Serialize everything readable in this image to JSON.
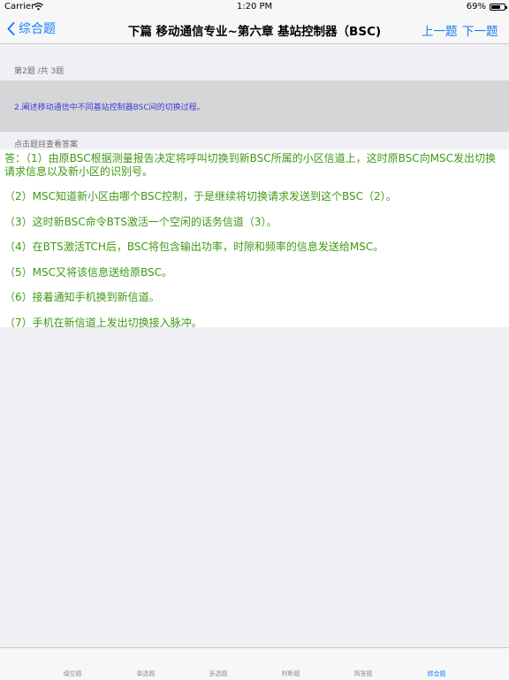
{
  "status_bar": {
    "carrier": "Carrier",
    "time": "1:20 PM",
    "battery": "69%",
    "battery_level": 0.69
  },
  "nav": {
    "back_label": "综合题",
    "title": "下篇 移动通信专业~第六章 基站控制器（BSC)",
    "prev_label": "上一题",
    "next_label": "下一题"
  },
  "question": {
    "progress": "第2题 /共 3题",
    "text": "2.阐述移动通信中不同基站控制器BSC间的切换过程。",
    "hint": "点击题目查看答案"
  },
  "answer": {
    "lines": [
      "答：（1）由原BSC根据测量报告决定将呼叫切换到新BSC所属的小区信道上，这时原BSC向MSC发出切换请求信息以及新小区的识别号。",
      "（2）MSC知道新小区由哪个BSC控制，于是继续将切换请求发送到这个BSC（2）。",
      "（3）这时新BSC命令BTS激活一个空闲的话务信道（3）。",
      "（4）在BTS激活TCH后，BSC将包含输出功率，时隙和频率的信息发送给MSC。",
      "（5）MSC又将该信息送给原BSC。",
      "（6）接着通知手机换到新信道。",
      "（7）手机在新信道上发出切换接入脉冲。"
    ]
  },
  "tabs": [
    {
      "label": "填空题",
      "active": false
    },
    {
      "label": "单选题",
      "active": false
    },
    {
      "label": "多选题",
      "active": false
    },
    {
      "label": "判断题",
      "active": false
    },
    {
      "label": "简答题",
      "active": false
    },
    {
      "label": "综合题",
      "active": true
    }
  ],
  "colors": {
    "accent": "#1a7cf9",
    "answer_text": "#3d9a12",
    "question_text": "#3b3bd8",
    "question_bg": "#d6d6d8",
    "page_bg": "#efeff4"
  },
  "icons": {
    "back": "chevron-left-icon",
    "wifi": "wifi-icon",
    "battery": "battery-icon"
  }
}
